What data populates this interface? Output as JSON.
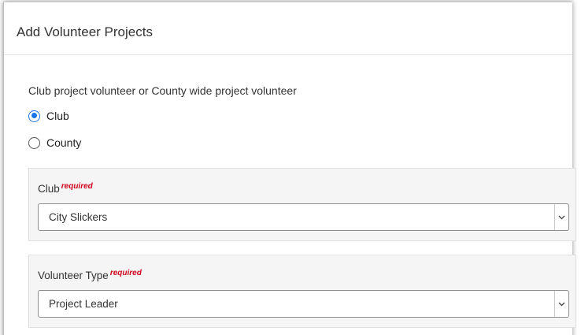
{
  "dialog": {
    "title": "Add Volunteer Projects"
  },
  "form": {
    "question": "Club project volunteer or County wide project volunteer",
    "options": [
      {
        "label": "Club",
        "checked": true
      },
      {
        "label": "County",
        "checked": false
      }
    ],
    "club_field": {
      "label": "Club",
      "required_text": "required",
      "selected": "City Slickers"
    },
    "volunteer_type_field": {
      "label": "Volunteer Type",
      "required_text": "required",
      "selected": "Project Leader"
    }
  },
  "colors": {
    "accent": "#1a73e8",
    "required": "#d0021b",
    "panel_bg": "#f5f5f5"
  },
  "icons": {
    "select_caret": "chevron-down-icon"
  }
}
